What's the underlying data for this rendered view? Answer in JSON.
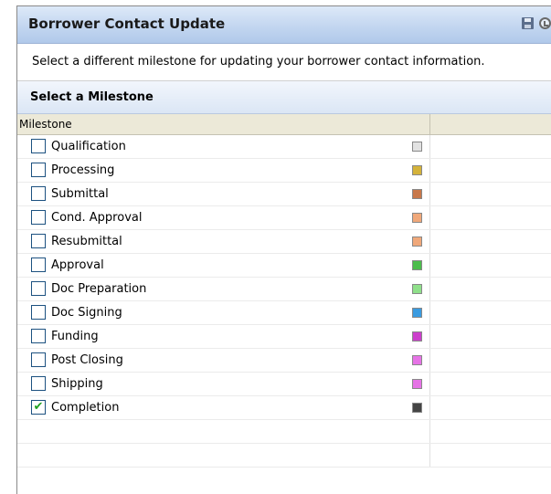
{
  "window": {
    "title": "Borrower Contact Update",
    "icons": [
      "save-icon",
      "refresh-icon"
    ]
  },
  "instruction": "Select a different milestone for updating your borrower contact information.",
  "section": {
    "title": "Select a Milestone"
  },
  "table": {
    "column_header": "Milestone",
    "rows": [
      {
        "label": "Qualification",
        "checked": false,
        "color": "#e2e2e2"
      },
      {
        "label": "Processing",
        "checked": false,
        "color": "#d4b23a"
      },
      {
        "label": "Submittal",
        "checked": false,
        "color": "#c8784a"
      },
      {
        "label": "Cond. Approval",
        "checked": false,
        "color": "#f0a87a"
      },
      {
        "label": "Resubmittal",
        "checked": false,
        "color": "#f0a87a"
      },
      {
        "label": "Approval",
        "checked": false,
        "color": "#4cbd4c"
      },
      {
        "label": "Doc Preparation",
        "checked": false,
        "color": "#8fe08a"
      },
      {
        "label": "Doc Signing",
        "checked": false,
        "color": "#3a9be0"
      },
      {
        "label": "Funding",
        "checked": false,
        "color": "#cc3fcc"
      },
      {
        "label": "Post Closing",
        "checked": false,
        "color": "#e673e6"
      },
      {
        "label": "Shipping",
        "checked": false,
        "color": "#e673e6"
      },
      {
        "label": "Completion",
        "checked": true,
        "color": "#444444"
      }
    ]
  }
}
